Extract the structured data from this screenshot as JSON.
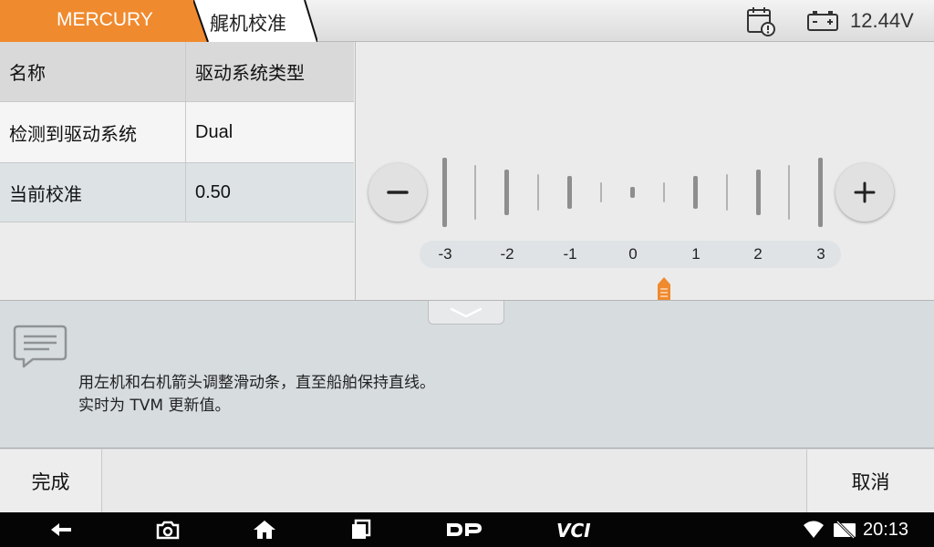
{
  "header": {
    "brand": "MERCURY",
    "breadcrumb": "艉机校准",
    "voltage": "12.44V",
    "icons": [
      "calendar-alert-icon",
      "battery-icon"
    ],
    "colors": {
      "brand_tab": "#f08a2e"
    }
  },
  "table": {
    "headers": [
      "名称",
      "驱动系统类型"
    ],
    "rows": [
      [
        "检测到驱动系统",
        "Dual"
      ],
      [
        "当前校准",
        "0.50"
      ]
    ]
  },
  "slider": {
    "scale_labels": [
      "-3",
      "-2",
      "-1",
      "0",
      "1",
      "2",
      "3"
    ],
    "current_value": 0.5,
    "minus_icon": "minus-icon",
    "plus_icon": "plus-icon",
    "pointer_color": "#f08a2e"
  },
  "message": {
    "line1": "用左机和右机箭头调整滑动条，直至船舶保持直线。",
    "line2": "实时为 TVM 更新值。"
  },
  "actions": {
    "done": "完成",
    "cancel": "取消"
  },
  "system_bar": {
    "time": "20:13",
    "icons": [
      "back-icon",
      "camera-icon",
      "home-icon",
      "recents-icon",
      "dp-icon",
      "vci-icon",
      "wifi-icon",
      "no-sim-icon"
    ]
  }
}
